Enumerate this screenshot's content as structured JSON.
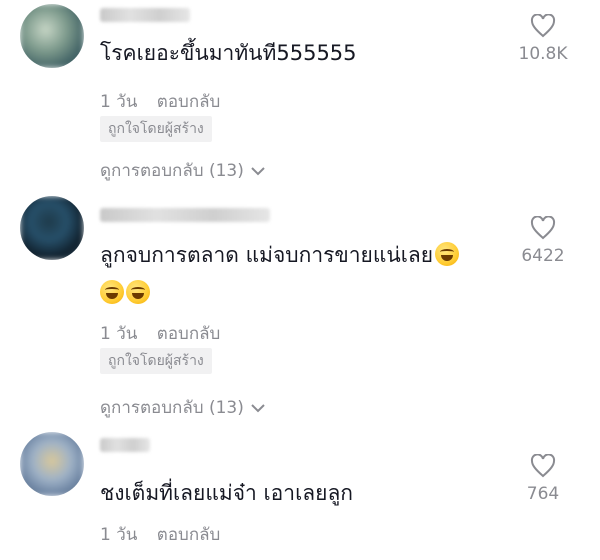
{
  "comments": [
    {
      "text": "โรคเยอะขึ้นมาทันที555555",
      "text_line2": "",
      "time": "1 วัน",
      "reply_label": "ตอบกลับ",
      "creator_badge": "ถูกใจโดยผู้สร้าง",
      "view_replies": "ดูการตอบกลับ (13)",
      "likes": "10.8K"
    },
    {
      "text": "ลูกจบการตลาด แม่จบการขายแน่เลย",
      "text_line2": "",
      "time": "1 วัน",
      "reply_label": "ตอบกลับ",
      "creator_badge": "ถูกใจโดยผู้สร้าง",
      "view_replies": "ดูการตอบกลับ (13)",
      "likes": "6422"
    },
    {
      "text": "ชงเต็มที่เลยแม่จ๋า เอาเลยลูก",
      "time": "1 วัน",
      "reply_label": "ตอบกลับ",
      "likes": "764"
    }
  ],
  "icons": {
    "like": "heart-outline-icon",
    "expand": "chevron-down-icon",
    "emoji": "grinning-squinting-face"
  },
  "colors": {
    "primary_text": "#161823",
    "secondary_text": "#8a8b91",
    "badge_bg": "#f1f1f2"
  }
}
